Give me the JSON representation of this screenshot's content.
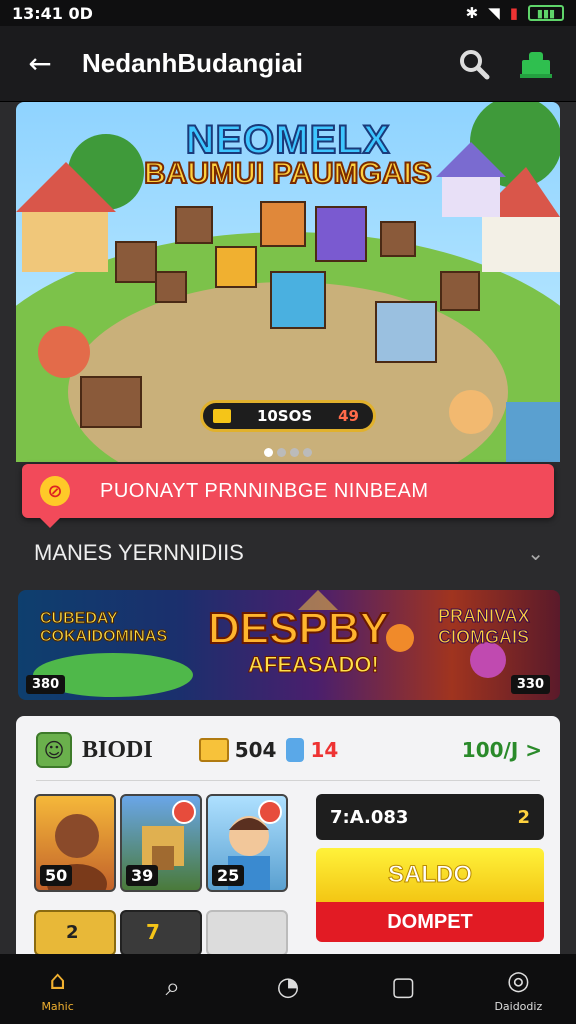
{
  "status_bar": {
    "time": "13:41 0D"
  },
  "app_bar": {
    "title": "NedanhBudangiai",
    "back_icon": "←",
    "search_icon": "⚲",
    "cart_icon": "cart-icon"
  },
  "hero": {
    "title_line1": "NEOMELX",
    "title_line2": "BAUMUI PAUMGAIS",
    "timer_value": "10SOS",
    "timer_count": "49",
    "slide_count": 4,
    "active_slide": 0
  },
  "promo": {
    "label": "PUONAYT PRNNINBGE NINBEAM",
    "icon": "ticket-icon"
  },
  "section": {
    "title": "MANES YERNNIDIIS",
    "chevron": "⌄"
  },
  "banner": {
    "left_text": "CUBEDAY\nCOKAIDOMINAS",
    "center_text": "DESPBY",
    "center_sub": "AFEASADO!",
    "right_text": "PRANIVAX\nCIOMGAIS",
    "tag_left": "380",
    "tag_right": "330"
  },
  "profile": {
    "name": "BIODI",
    "crowns": "504",
    "trophies": "14",
    "more_label": "100/J >",
    "tiles": [
      {
        "level": "50"
      },
      {
        "level": "39"
      },
      {
        "level": "25"
      }
    ],
    "tile_small_1": "2",
    "tile_small_2": "7"
  },
  "wallet": {
    "value": "7:A.083",
    "icon_text": "2",
    "saldo_label": "SALDO",
    "dompet_label": "DOMPET"
  },
  "bottom_nav": [
    {
      "label": "Mahic",
      "icon": "⌂",
      "active": true
    },
    {
      "label": "",
      "icon": "⌕",
      "active": false
    },
    {
      "label": "",
      "icon": "◔",
      "active": false
    },
    {
      "label": "",
      "icon": "▢",
      "active": false
    },
    {
      "label": "Daidodiz",
      "icon": "◎",
      "active": false
    }
  ],
  "colors": {
    "promo": "#f24a5a",
    "accent": "#f0b030",
    "more": "#2a8a2a",
    "dompet": "#e21b24",
    "saldo": "#f3c614"
  }
}
